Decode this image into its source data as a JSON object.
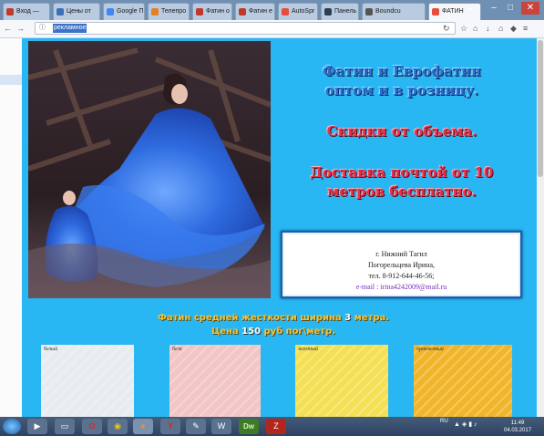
{
  "browser": {
    "tabs": [
      {
        "label": "Вход —",
        "color": "#c0392b"
      },
      {
        "label": "Цены от",
        "color": "#3b6fb6"
      },
      {
        "label": "Google П",
        "color": "#4285f4"
      },
      {
        "label": "Телепро",
        "color": "#e67e22"
      },
      {
        "label": "Фатин о",
        "color": "#c0392b"
      },
      {
        "label": "Фатин е",
        "color": "#c0392b"
      },
      {
        "label": "AutoSpr",
        "color": "#e74c3c"
      },
      {
        "label": "Панель у",
        "color": "#2c3e50"
      },
      {
        "label": "Boundcu",
        "color": "#555555"
      },
      {
        "label": "ФАТИН",
        "color": "#e74c3c"
      }
    ],
    "new_tab": "+",
    "url": "рекламное",
    "window_controls": [
      "–",
      "□",
      "✕"
    ]
  },
  "hero": {
    "line1": "Фатин и Еврофатин",
    "line2": "оптом и в розницу.",
    "line3": "Скидки от объема.",
    "line4": "Доставка почтой от 10",
    "line5": "метров бесплатно."
  },
  "contact": {
    "city": "г. Нижний Тагил",
    "name": "Погорельцева Ирина,",
    "phone": "тел. 8-912-644-46-56;",
    "email": "e-mail : irina4242009@mail.ru"
  },
  "fabric": {
    "line1_pre": "Фатин средней жесткости  ширина ",
    "line1_num": "3",
    "line1_post": " метра.",
    "line2_pre": "Цена ",
    "line2_num": "150",
    "line2_post": " руб пог\\метр."
  },
  "swatches": [
    {
      "label": "белый",
      "color": "#e9ecef"
    },
    {
      "label": "беж",
      "color": "#f2c6c4"
    },
    {
      "label": "желтый",
      "color": "#f4e055"
    },
    {
      "label": "оранжевый",
      "color": "#f0b52a"
    }
  ],
  "taskbar": {
    "lang": "RU",
    "time": "11:49",
    "date": "04.03.2017"
  }
}
